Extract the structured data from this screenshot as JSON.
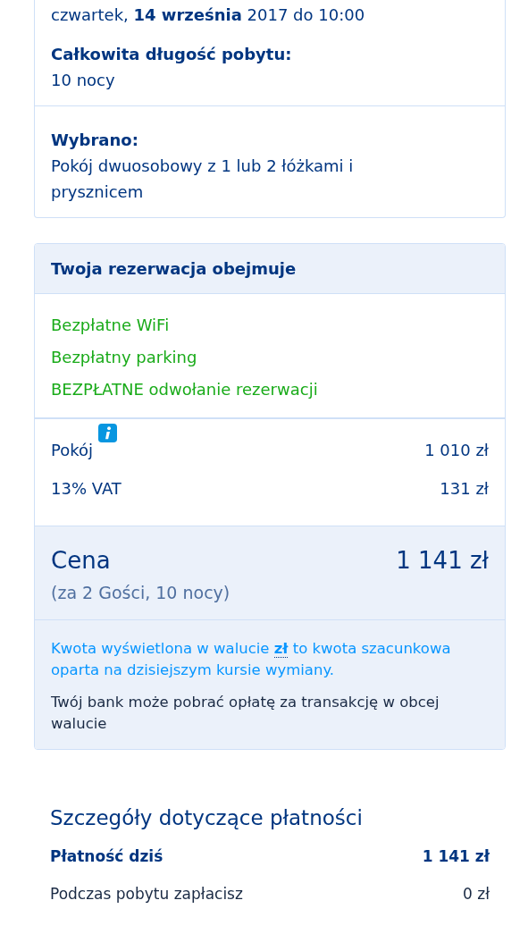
{
  "stay": {
    "checkout_line": "czwartek, **14 września** 2017 do 10:00",
    "length_label": "Całkowita długość pobytu:",
    "length_value": "10 nocy",
    "selected_label": "Wybrano:",
    "selected_value": "Pokój dwuosobowy z 1 lub 2 łóżkami i prysznicem"
  },
  "reservation": {
    "title": "Twoja rezerwacja obejmuje",
    "perks": [
      "Bezpłatne WiFi",
      "Bezpłatny parking",
      "BEZPŁATNE odwołanie rezerwacji"
    ],
    "lines": [
      {
        "label": "Pokój",
        "amount": "1 010 zł",
        "info": true
      },
      {
        "label": "13% VAT",
        "amount": "131 zł",
        "info": false
      }
    ],
    "price": {
      "label": "Cena",
      "amount": "1 141 zł",
      "note": "(za 2 Gości, 10 nocy)"
    },
    "currency_note": "Kwota wyświetlona w walucie **zł** to kwota szacunkowa oparta na dzisiejszym kursie wymiany.",
    "bank_note": "Twój bank może pobrać opłatę za transakcję w obcej walucie"
  },
  "payment": {
    "title": "Szczegóły dotyczące płatności",
    "rows": [
      {
        "label": "Płatność dziś",
        "amount": "1 141 zł",
        "emphasis": true
      },
      {
        "label": "Podczas pobytu zapłacisz",
        "amount": "0 zł",
        "emphasis": false
      }
    ]
  }
}
